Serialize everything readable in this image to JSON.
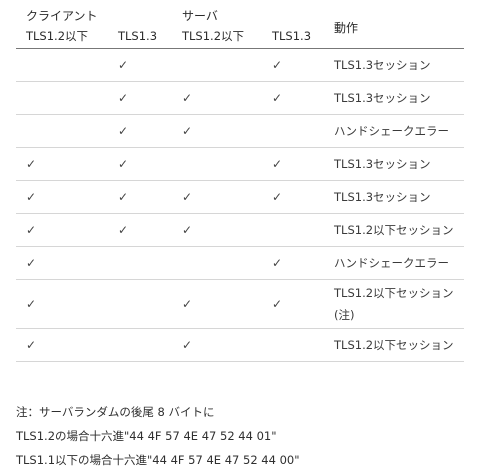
{
  "header": {
    "client_group": "クライアント",
    "server_group": "サーバ",
    "action": "動作",
    "client_cols": [
      "TLS1.2以下",
      "TLS1.3"
    ],
    "server_cols": [
      "TLS1.2以下",
      "TLS1.3"
    ]
  },
  "check_glyph": "✓",
  "rows": [
    {
      "c12": "",
      "c13": "✓",
      "s12": "",
      "s13": "✓",
      "action": "TLS1.3セッション",
      "note": ""
    },
    {
      "c12": "",
      "c13": "✓",
      "s12": "✓",
      "s13": "✓",
      "action": "TLS1.3セッション",
      "note": ""
    },
    {
      "c12": "",
      "c13": "✓",
      "s12": "✓",
      "s13": "",
      "action": "ハンドシェークエラー",
      "note": ""
    },
    {
      "c12": "✓",
      "c13": "✓",
      "s12": "",
      "s13": "✓",
      "action": "TLS1.3セッション",
      "note": ""
    },
    {
      "c12": "✓",
      "c13": "✓",
      "s12": "✓",
      "s13": "✓",
      "action": "TLS1.3セッション",
      "note": ""
    },
    {
      "c12": "✓",
      "c13": "✓",
      "s12": "✓",
      "s13": "",
      "action": "TLS1.2以下セッション",
      "note": ""
    },
    {
      "c12": "✓",
      "c13": "",
      "s12": "",
      "s13": "✓",
      "action": "ハンドシェークエラー",
      "note": ""
    },
    {
      "c12": "✓",
      "c13": "",
      "s12": "✓",
      "s13": "✓",
      "action": "TLS1.2以下セッション",
      "note": "(注)"
    },
    {
      "c12": "✓",
      "c13": "",
      "s12": "✓",
      "s13": "",
      "action": "TLS1.2以下セッション",
      "note": ""
    }
  ],
  "footnote": {
    "lines": [
      "注：サーバランダムの後尾 8 バイトに",
      "TLS1.2の場合十六進\"44 4F 57 4E 47 52 44 01\"",
      "TLS1.1以下の場合十六進\"44 4F 57 4E 47 52 44 00\""
    ]
  }
}
